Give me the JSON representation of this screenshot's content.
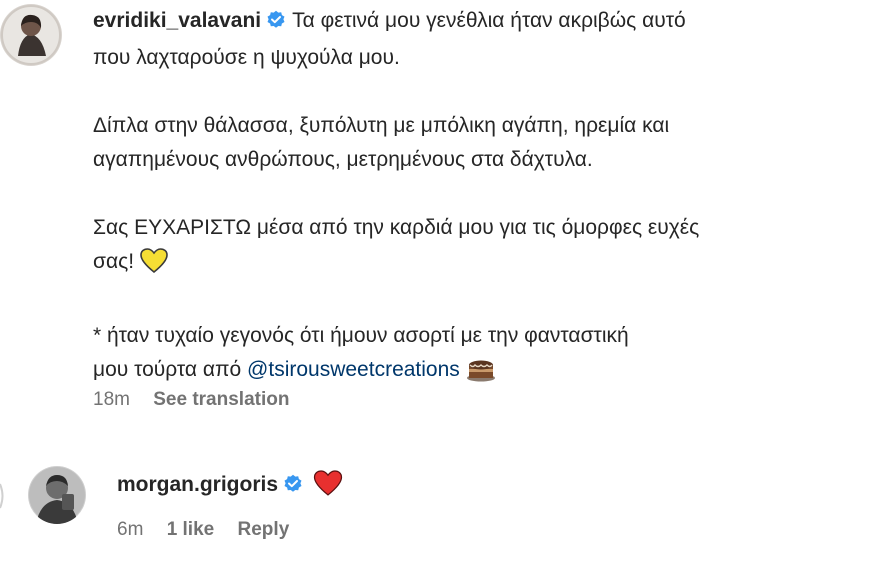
{
  "post": {
    "username": "evridiki_valavani",
    "paragraphs": [
      [
        "Τα φετινά μου γενέθλια ήταν ακριβώς αυτό",
        "που λαχταρούσε η ψυχούλα μου."
      ],
      [
        "Δίπλα στην θάλασσα, ξυπόλυτη με μπόλικη αγάπη, ηρεμία και",
        "αγαπημένους ανθρώπους, μετρημένους στα δάχτυλα."
      ],
      [
        "Σας ΕΥΧΑΡΙΣΤΩ μέσα από την καρδιά μου για τις όμορφες ευχές",
        "σας!"
      ],
      [
        "* ήταν τυχαίο γεγονός ότι ήμουν ασορτί με την φανταστική",
        "μου τούρτα από"
      ]
    ],
    "mention": "@tsirousweetcreations",
    "time": "18m",
    "see_translation": "See translation",
    "icons": {
      "verified": "verified-badge-icon",
      "heart": "yellow-heart-emoji",
      "cake": "cake-emoji"
    },
    "colors": {
      "verified": "#3897f0",
      "mention": "#00376b",
      "yellow_heart": "#f6de34"
    }
  },
  "reply": {
    "username": "morgan.grigoris",
    "time": "6m",
    "likes": "1 like",
    "reply_label": "Reply",
    "icons": {
      "verified": "verified-badge-icon",
      "heart": "red-heart-emoji"
    },
    "colors": {
      "red_heart": "#e8302f"
    }
  }
}
